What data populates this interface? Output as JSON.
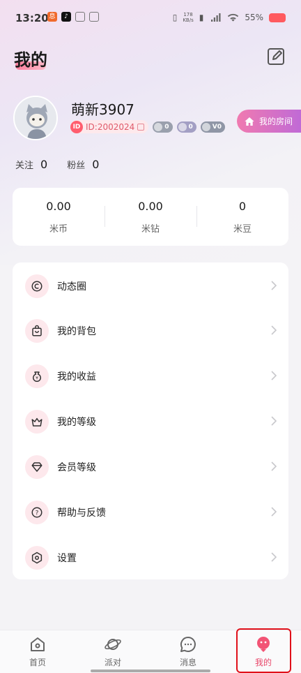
{
  "status_bar": {
    "time": "13:20",
    "net_speed_value": "178",
    "net_speed_unit": "KB/s",
    "battery": "55%"
  },
  "header": {
    "title": "我的"
  },
  "profile": {
    "nickname": "萌新3907",
    "id_badge": "ID",
    "id_text": "ID:2002024",
    "levels": [
      "0",
      "0",
      "V0"
    ],
    "room_button": "我的房间"
  },
  "social": {
    "following_label": "关注",
    "following_count": "0",
    "fans_label": "粉丝",
    "fans_count": "0"
  },
  "wallet": [
    {
      "value": "0.00",
      "label": "米币"
    },
    {
      "value": "0.00",
      "label": "米钻"
    },
    {
      "value": "0",
      "label": "米豆"
    }
  ],
  "menu": [
    {
      "label": "动态圈",
      "icon": "moments-icon"
    },
    {
      "label": "我的背包",
      "icon": "backpack-icon"
    },
    {
      "label": "我的收益",
      "icon": "earnings-icon"
    },
    {
      "label": "我的等级",
      "icon": "crown-icon"
    },
    {
      "label": "会员等级",
      "icon": "diamond-icon"
    },
    {
      "label": "帮助与反馈",
      "icon": "help-icon"
    },
    {
      "label": "设置",
      "icon": "settings-icon"
    }
  ],
  "bottom_nav": [
    {
      "label": "首页",
      "icon": "home-icon"
    },
    {
      "label": "派对",
      "icon": "planet-icon"
    },
    {
      "label": "消息",
      "icon": "message-icon"
    },
    {
      "label": "我的",
      "icon": "me-icon",
      "active": true
    }
  ],
  "colors": {
    "accent": "#e8476a",
    "highlight_box": "#e0101a",
    "menu_icon_bg": "#fde8ec"
  }
}
